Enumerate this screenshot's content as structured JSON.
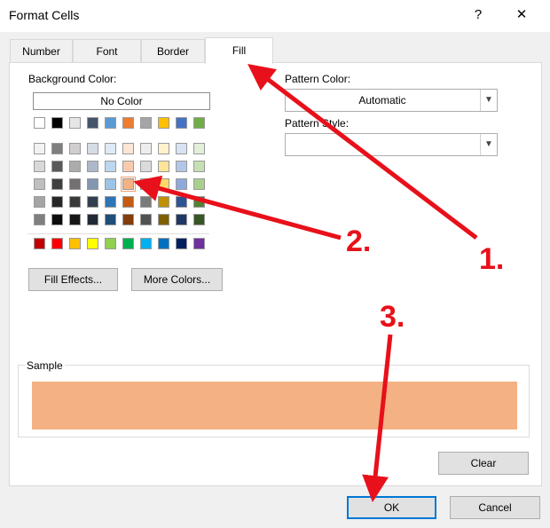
{
  "dialog": {
    "title": "Format Cells",
    "help_glyph": "?",
    "close_glyph": "✕"
  },
  "tabs": [
    {
      "label": "Number"
    },
    {
      "label": "Font"
    },
    {
      "label": "Border"
    },
    {
      "label": "Fill",
      "active": true
    }
  ],
  "fill": {
    "background_color_label": "Background Color:",
    "no_color_label": "No Color",
    "theme_row_1": [
      "#ffffff",
      "#000000",
      "#e7e6e6",
      "#44546a",
      "#5b9bd5",
      "#ed7d31",
      "#a5a5a5",
      "#ffc000",
      "#4472c4",
      "#70ad47"
    ],
    "tint_rows": [
      [
        "#f2f2f2",
        "#7f7f7f",
        "#d0cece",
        "#d6dce4",
        "#deebf6",
        "#fbe5d5",
        "#ededed",
        "#fff2cc",
        "#d9e2f3",
        "#e2efd9"
      ],
      [
        "#d8d8d8",
        "#595959",
        "#aeabab",
        "#adb9ca",
        "#bdd7ee",
        "#f8cbad",
        "#dbdbdb",
        "#fee599",
        "#b4c6e7",
        "#c5e0b3"
      ],
      [
        "#bfbfbf",
        "#3f3f3f",
        "#757070",
        "#8496b0",
        "#9dc3e6",
        "#f4b183",
        "#c9c9c9",
        "#ffd965",
        "#8eaadb",
        "#a8d08d"
      ],
      [
        "#a5a5a5",
        "#262626",
        "#3a3838",
        "#323f4f",
        "#2e75b5",
        "#c55a11",
        "#7b7b7b",
        "#bf9000",
        "#2f5496",
        "#538135"
      ],
      [
        "#7f7f7f",
        "#0c0c0c",
        "#171616",
        "#222a35",
        "#1e4e79",
        "#833c0b",
        "#525252",
        "#7f6000",
        "#1f3864",
        "#375623"
      ]
    ],
    "standard_colors": [
      "#c00000",
      "#ff0000",
      "#ffc000",
      "#ffff00",
      "#92d050",
      "#00b050",
      "#00b0f0",
      "#0070c0",
      "#002060",
      "#7030a0"
    ],
    "fill_effects_label": "Fill Effects...",
    "more_colors_label": "More Colors...",
    "pattern_color_label": "Pattern Color:",
    "pattern_color_value": "Automatic",
    "pattern_style_label": "Pattern Style:",
    "pattern_style_value": "",
    "sample_label": "Sample",
    "sample_color": "#f4b183",
    "selected_color": "#f4b183"
  },
  "buttons": {
    "clear": "Clear",
    "ok": "OK",
    "cancel": "Cancel"
  },
  "annotations": {
    "arrow_color": "#e8101a",
    "step1": "1.",
    "step2": "2.",
    "step3": "3."
  }
}
